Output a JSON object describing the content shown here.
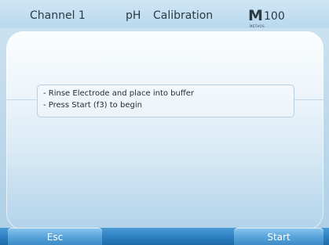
{
  "header": {
    "channel": "Channel 1",
    "unit": "pH",
    "mode": "Calibration",
    "logo_letter": "M",
    "logo_number": "100",
    "logo_sub": "METHOS"
  },
  "message": {
    "lines": [
      "- Rinse Electrode and place into  buffer",
      "- Press Start (f3) to begin"
    ]
  },
  "softkeys": {
    "esc": "Esc",
    "start": "Start"
  },
  "colors": {
    "softkey": "#5aa6dc",
    "footer_bar": "#2c7fc0",
    "screen_bg": "#bcd7ea"
  }
}
